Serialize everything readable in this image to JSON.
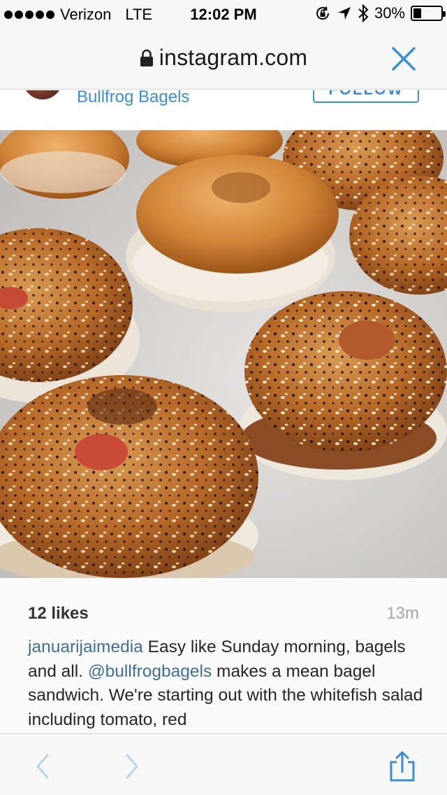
{
  "status_bar": {
    "carrier": "Verizon",
    "network": "LTE",
    "time": "12:02 PM",
    "battery_text": "30%",
    "battery_level": 0.3,
    "icons": [
      "signal-dots-icon",
      "rotation-lock-icon",
      "location-arrow-icon",
      "bluetooth-icon",
      "battery-icon"
    ]
  },
  "url_bar": {
    "domain": "instagram.com",
    "icons": [
      "lock-icon",
      "close-icon"
    ]
  },
  "profile": {
    "username": "Bullfrog Bagels",
    "follow_label": "FOLLOW"
  },
  "post": {
    "likes": "12 likes",
    "timestamp": "13m",
    "caption": {
      "author": "januarijaimedia",
      "text_1": " Easy like Sunday morning, bagels and all. ",
      "mention": "@bullfrogbagels",
      "text_2": " makes a mean bagel sandwich. We're starting out with the whitefish salad including tomato, red"
    }
  },
  "toolbar": {
    "icons": [
      "back-icon",
      "forward-icon",
      "share-icon"
    ]
  },
  "colors": {
    "accent": "#3b8fd1",
    "chrome_bg": "#f7f7f7",
    "text": "#262626",
    "muted": "#a5a5a5"
  }
}
